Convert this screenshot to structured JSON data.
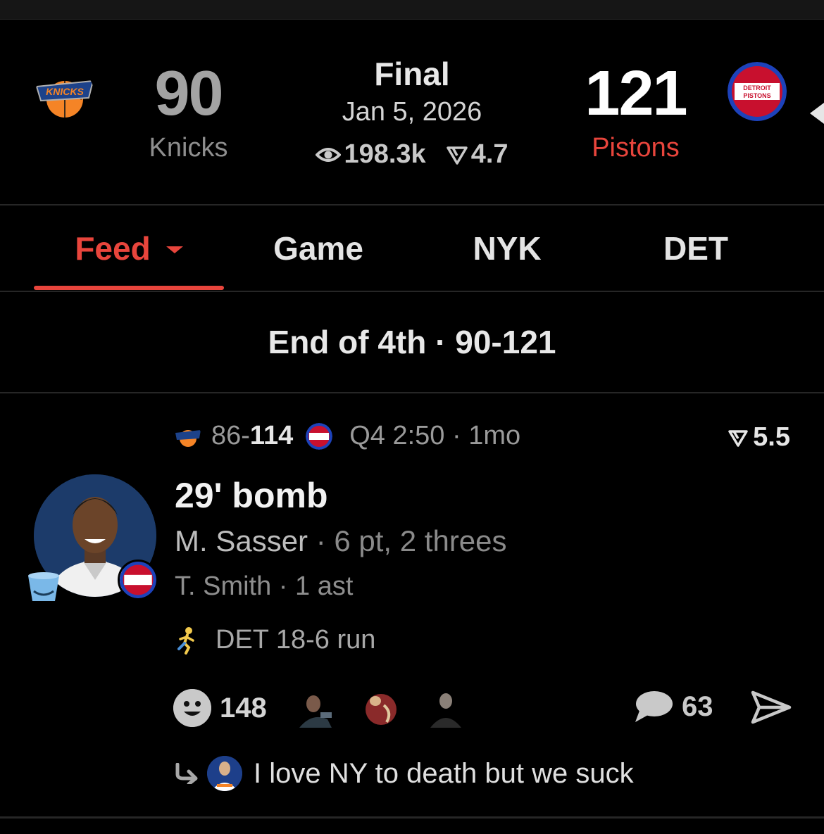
{
  "game": {
    "status": "Final",
    "date": "Jan 5, 2026",
    "views": "198.3k",
    "rating": "4.7",
    "away": {
      "score": "90",
      "name": "Knicks",
      "logo": "knicks-logo",
      "logo_text": "KNICKS",
      "color": "#f58426"
    },
    "home": {
      "score": "121",
      "name": "Pistons",
      "logo": "pistons-logo",
      "logo_text_1": "DETROIT",
      "logo_text_2": "PISTONS",
      "color": "#c8102e"
    }
  },
  "tabs": [
    {
      "label": "Feed",
      "active": true
    },
    {
      "label": "Game",
      "active": false
    },
    {
      "label": "NYK",
      "active": false
    },
    {
      "label": "DET",
      "active": false
    }
  ],
  "period": {
    "label": "End of 4th · 90-121"
  },
  "play": {
    "score_away": "86-",
    "score_home": "114",
    "clock": "Q4 2:50 · 1mo",
    "rating": "5.5",
    "title": "29' bomb",
    "player": "M. Sasser",
    "player_stats": " · 6 pt, 2 threes",
    "assist": "T. Smith · 1 ast",
    "run": "DET 18-6 run",
    "reactions_count": "148",
    "comments_count": "63",
    "reply_text": "I love NY to death but we suck"
  },
  "colors": {
    "accent": "#e8453c",
    "background": "#000000"
  }
}
